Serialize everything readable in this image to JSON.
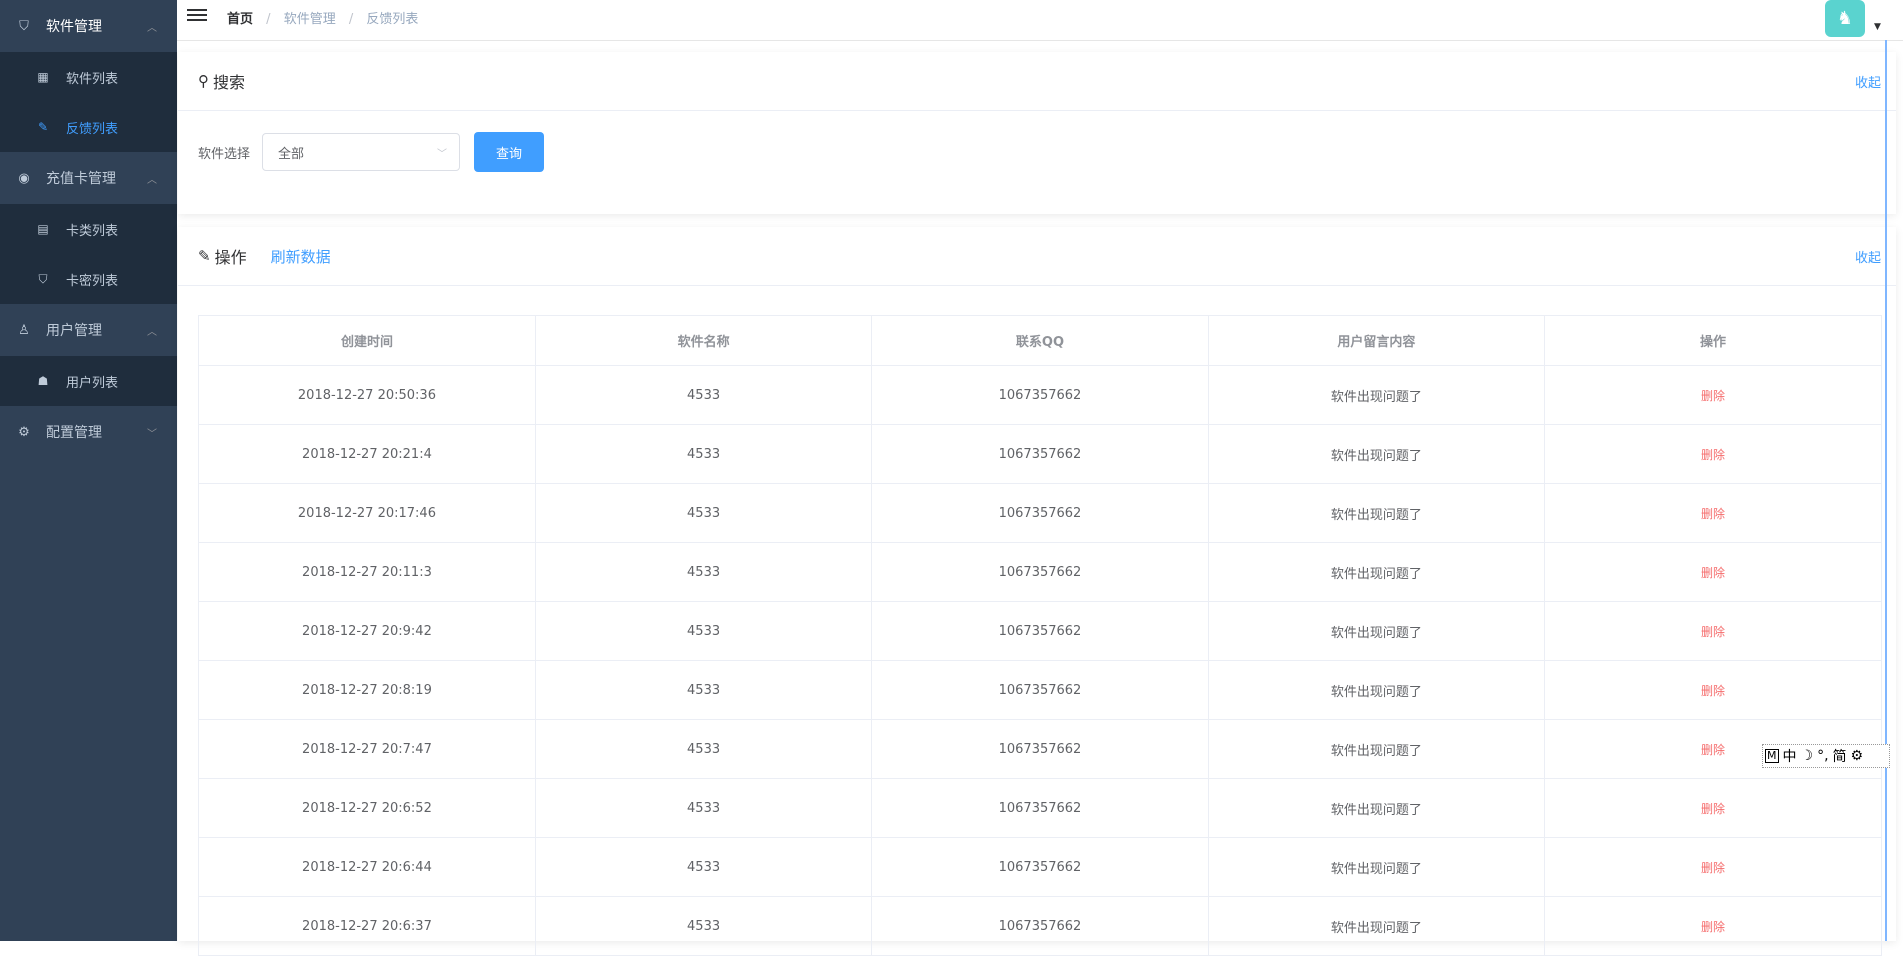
{
  "sidebar": {
    "groups": [
      {
        "label": "软件管理",
        "icon": "shield-icon",
        "expanded": true,
        "items": [
          {
            "label": "软件列表",
            "icon": "table-icon",
            "active": false
          },
          {
            "label": "反馈列表",
            "icon": "edit-icon",
            "active": true
          }
        ]
      },
      {
        "label": "充值卡管理",
        "icon": "coin-icon",
        "expanded": true,
        "items": [
          {
            "label": "卡类列表",
            "icon": "card-icon",
            "active": false
          },
          {
            "label": "卡密列表",
            "icon": "badge-icon",
            "active": false
          }
        ]
      },
      {
        "label": "用户管理",
        "icon": "user-group-icon",
        "expanded": true,
        "items": [
          {
            "label": "用户列表",
            "icon": "user-icon",
            "active": false
          }
        ]
      },
      {
        "label": "配置管理",
        "icon": "gear-icon",
        "expanded": false,
        "items": []
      }
    ]
  },
  "header": {
    "breadcrumb": [
      "首页",
      "软件管理",
      "反馈列表"
    ]
  },
  "search": {
    "title": "搜索",
    "collapse": "收起",
    "label": "软件选择",
    "selected": "全部",
    "button": "查询"
  },
  "ops": {
    "title": "操作",
    "refresh": "刷新数据",
    "collapse": "收起"
  },
  "table": {
    "columns": [
      "创建时间",
      "软件名称",
      "联系QQ",
      "用户留言内容",
      "操作"
    ],
    "rows": [
      [
        "2018-12-27 20:50:36",
        "4533",
        "1067357662",
        "软件出现问题了",
        "删除"
      ],
      [
        "2018-12-27 20:21:4",
        "4533",
        "1067357662",
        "软件出现问题了",
        "删除"
      ],
      [
        "2018-12-27 20:17:46",
        "4533",
        "1067357662",
        "软件出现问题了",
        "删除"
      ],
      [
        "2018-12-27 20:11:3",
        "4533",
        "1067357662",
        "软件出现问题了",
        "删除"
      ],
      [
        "2018-12-27 20:9:42",
        "4533",
        "1067357662",
        "软件出现问题了",
        "删除"
      ],
      [
        "2018-12-27 20:8:19",
        "4533",
        "1067357662",
        "软件出现问题了",
        "删除"
      ],
      [
        "2018-12-27 20:7:47",
        "4533",
        "1067357662",
        "软件出现问题了",
        "删除"
      ],
      [
        "2018-12-27 20:6:52",
        "4533",
        "1067357662",
        "软件出现问题了",
        "删除"
      ],
      [
        "2018-12-27 20:6:44",
        "4533",
        "1067357662",
        "软件出现问题了",
        "删除"
      ],
      [
        "2018-12-27 20:6:37",
        "4533",
        "1067357662",
        "软件出现问题了",
        "删除"
      ]
    ]
  },
  "ime": [
    "M",
    "中",
    "☽",
    "°,",
    "简",
    "⚙"
  ],
  "colors": {
    "sidebar_bg": "#304156",
    "submenu_bg": "#1f2d3d",
    "accent": "#409eff",
    "danger": "#f56c6c"
  }
}
